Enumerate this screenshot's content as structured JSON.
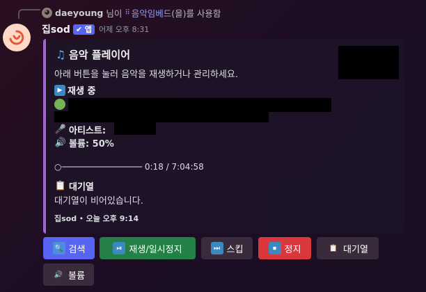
{
  "reply": {
    "username": "daeyoung",
    "suffix_1": "님이",
    "command": "음악임베드",
    "suffix_2": "(을)를 사용함"
  },
  "message": {
    "author": "집sod",
    "badge": "✔ 앱",
    "timestamp": "어제 오후 8:31"
  },
  "embed": {
    "accent_color": "#a063d8",
    "title": "음악 플레이어",
    "description": "아래 버튼을 눌러 음악을 재생하거나 관리하세요.",
    "now_playing": {
      "label": "재생 중"
    },
    "artist": {
      "label": "아티스트:"
    },
    "volume": {
      "text": "볼륨: 50%"
    },
    "progress": {
      "text": "○──────────────── 0:18 / 7:04:58"
    },
    "queue": {
      "label": "대기열",
      "value": "대기열이 비어있습니다."
    },
    "footer": {
      "author": "집sod",
      "separator": "•",
      "time": "오늘 오후 9:14"
    }
  },
  "buttons": [
    {
      "label": "검색",
      "icon": "magnifier-icon",
      "style": "blurple"
    },
    {
      "label": "재생/일시정지",
      "icon": "play-pause-icon",
      "style": "green"
    },
    {
      "label": "스킵",
      "icon": "next-track-icon",
      "style": "gray"
    },
    {
      "label": "정지",
      "icon": "stop-icon",
      "style": "red"
    },
    {
      "label": "대기열",
      "icon": "clipboard-icon",
      "style": "gray"
    },
    {
      "label": "볼륨",
      "icon": "speaker-icon",
      "style": "gray"
    }
  ]
}
